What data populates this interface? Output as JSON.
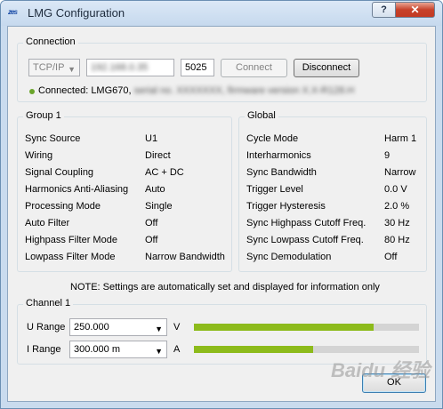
{
  "window": {
    "title": "LMG Configuration",
    "help_label": "?",
    "close_label": "✕",
    "icon_text": "zes"
  },
  "connection": {
    "legend": "Connection",
    "protocol": "TCP/IP",
    "address": "192.168.0.35",
    "port": "5025",
    "connect_label": "Connect",
    "disconnect_label": "Disconnect",
    "status_prefix": "Connected: LMG670,",
    "status_detail": "serial no. XXXXXXX, firmware version X.X-R128.H"
  },
  "group1": {
    "legend": "Group 1",
    "rows": [
      {
        "label": "Sync Source",
        "value": "U1"
      },
      {
        "label": "Wiring",
        "value": "Direct"
      },
      {
        "label": "Signal Coupling",
        "value": "AC + DC"
      },
      {
        "label": "Harmonics Anti-Aliasing",
        "value": "Auto"
      },
      {
        "label": "Processing Mode",
        "value": "Single"
      },
      {
        "label": "Auto Filter",
        "value": "Off"
      },
      {
        "label": "Highpass Filter Mode",
        "value": "Off"
      },
      {
        "label": "Lowpass Filter Mode",
        "value": "Narrow Bandwidth"
      }
    ]
  },
  "global": {
    "legend": "Global",
    "rows": [
      {
        "label": "Cycle Mode",
        "value": "Harm 1"
      },
      {
        "label": "Interharmonics",
        "value": "9"
      },
      {
        "label": "Sync Bandwidth",
        "value": "Narrow"
      },
      {
        "label": "Trigger Level",
        "value": "0.0 V"
      },
      {
        "label": "Trigger Hysteresis",
        "value": "2.0 %"
      },
      {
        "label": "Sync Highpass Cutoff Freq.",
        "value": "30 Hz"
      },
      {
        "label": "Sync Lowpass Cutoff Freq.",
        "value": "80 Hz"
      },
      {
        "label": "Sync Demodulation",
        "value": "Off"
      }
    ]
  },
  "note": "NOTE: Settings are automatically set and displayed for information only",
  "channel1": {
    "legend": "Channel 1",
    "u_range": {
      "label": "U Range",
      "value": "250.000",
      "unit": "V",
      "level": 0.8
    },
    "i_range": {
      "label": "I Range",
      "value": "300.000 m",
      "unit": "A",
      "level": 0.53
    }
  },
  "ok_label": "OK",
  "watermark": "Baidu 经验",
  "colors": {
    "accent_bar": "#8dbb1b",
    "status_dot": "#6aa52b",
    "title_bg": "#c9dbee"
  }
}
